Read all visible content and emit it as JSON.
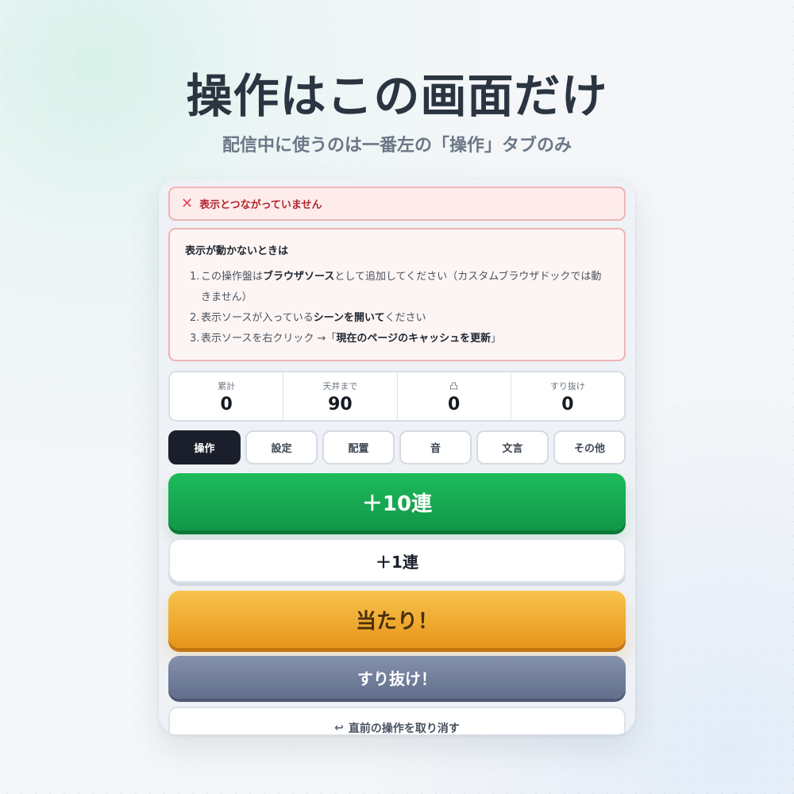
{
  "hero": {
    "title": "操作はこの画面だけ",
    "subtitle": "配信中に使うのは一番左の「操作」タブのみ"
  },
  "alert": {
    "icon": "close-icon",
    "text": "表示とつながっていません"
  },
  "help": {
    "title": "表示が動かないときは",
    "items": [
      {
        "num": "1.",
        "a": "この操作盤は",
        "b": "ブラウザソース",
        "c": "として追加してください（カスタムブラウザドックでは動きません）"
      },
      {
        "num": "2.",
        "a": "表示ソースが入っている",
        "b": "シーンを開いて",
        "c": "ください"
      },
      {
        "num": "3.",
        "a": "表示ソースを右クリック →「",
        "b": "現在のページのキャッシュを更新",
        "c": "」"
      }
    ]
  },
  "stats": [
    {
      "label": "累計",
      "value": "0"
    },
    {
      "label": "天井まで",
      "value": "90"
    },
    {
      "label": "凸",
      "value": "0"
    },
    {
      "label": "すり抜け",
      "value": "0"
    }
  ],
  "tabs": [
    "操作",
    "設定",
    "配置",
    "音",
    "文言",
    "その他"
  ],
  "active_tab": "操作",
  "buttons": {
    "plus10": "＋10連",
    "plus1": "＋1連",
    "hit": "当たり！",
    "miss": "すり抜け！",
    "undo_icon": "undo-arrow-icon",
    "undo": "直前の操作を取り消す"
  },
  "colors": {
    "primary_green": "#1aae55",
    "hit_orange": "#f0ac30",
    "miss_slate": "#717e9c",
    "alert_red": "#b3262f",
    "tab_active": "#1a1f2b"
  }
}
